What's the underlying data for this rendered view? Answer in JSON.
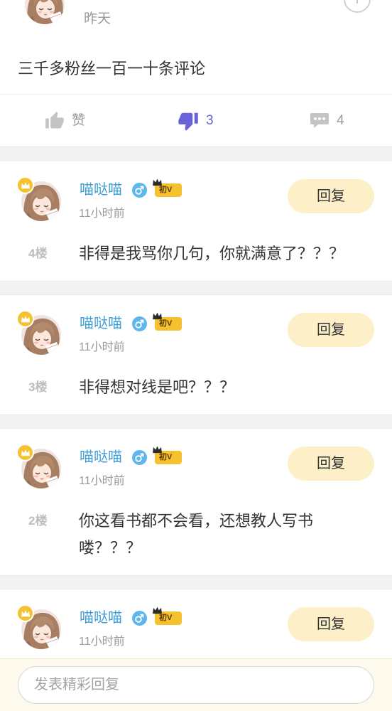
{
  "post": {
    "time": "昨天",
    "content": "三千多粉丝一百一十条评论",
    "actions": {
      "like_label": "赞",
      "dislike_count": "3",
      "dislike_active": true,
      "comment_count": "4"
    }
  },
  "comments": [
    {
      "name": "喵哒喵",
      "badge": "初V",
      "time": "11小时前",
      "reply_label": "回复",
      "floor": "4楼",
      "text": "非得是我骂你几句，你就满意了？？？"
    },
    {
      "name": "喵哒喵",
      "badge": "初V",
      "time": "11小时前",
      "reply_label": "回复",
      "floor": "3楼",
      "text": "非得想对线是吧？？？"
    },
    {
      "name": "喵哒喵",
      "badge": "初V",
      "time": "11小时前",
      "reply_label": "回复",
      "floor": "2楼",
      "text": "你这看书都不会看，还想教人写书喽？？？"
    },
    {
      "name": "喵哒喵",
      "badge": "初V",
      "time": "11小时前",
      "reply_label": "回复"
    }
  ],
  "reply_bar": {
    "placeholder": "发表精彩回复"
  },
  "icons": {
    "follow": "add-circle-icon",
    "like": "thumbs-up-icon",
    "dislike": "thumbs-down-icon",
    "comment": "comment-icon",
    "gender": "male-gender-icon",
    "avatar_badge": "crown-icon"
  },
  "colors": {
    "name": "#3d9dd9",
    "dislike_active": "#6a62d8",
    "reply_button_bg": "#fdf0c9",
    "level_badge": "#f6c12f",
    "gender_icon": "#5db6ee",
    "bottom_bar_bg": "#fdf9ec",
    "page_gap": "#f3f3f3",
    "muted_text": "#999999"
  }
}
